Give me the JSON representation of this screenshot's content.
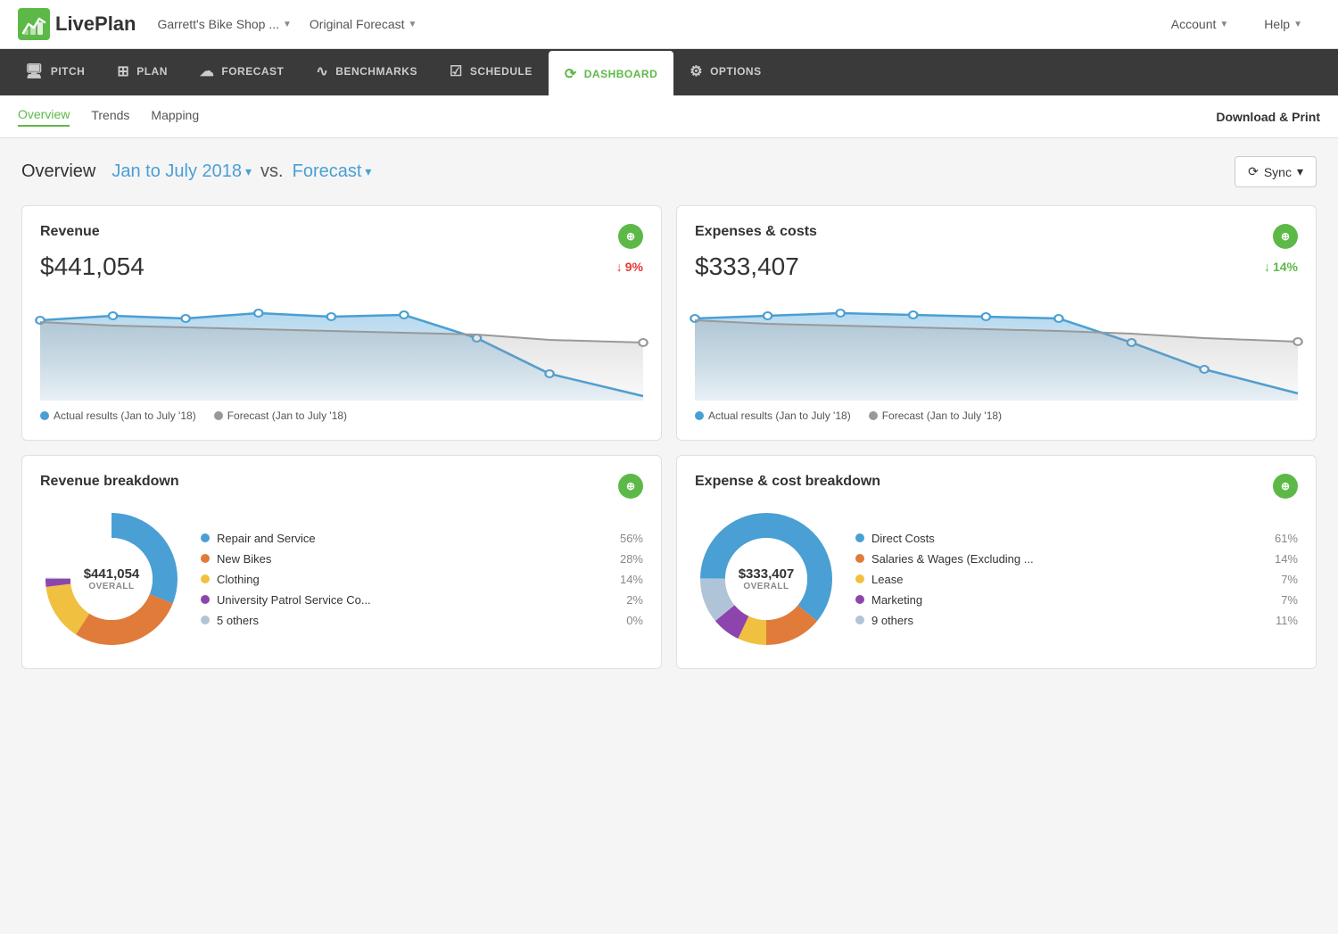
{
  "app": {
    "logo_text": "LivePlan",
    "company": "Garrett's Bike Shop ...",
    "forecast_mode": "Original Forecast",
    "account_label": "Account",
    "help_label": "Help"
  },
  "main_nav": {
    "tabs": [
      {
        "id": "pitch",
        "label": "PITCH",
        "icon": "🖥"
      },
      {
        "id": "plan",
        "label": "PLAN",
        "icon": "📋"
      },
      {
        "id": "forecast",
        "label": "FORECAST",
        "icon": "🔮"
      },
      {
        "id": "benchmarks",
        "label": "BENCHMARKS",
        "icon": "📈"
      },
      {
        "id": "schedule",
        "label": "SCHEDULE",
        "icon": "☑"
      },
      {
        "id": "dashboard",
        "label": "DASHBOARD",
        "icon": "🔄",
        "active": true
      },
      {
        "id": "options",
        "label": "OPTIONS",
        "icon": "⚙"
      }
    ]
  },
  "sub_nav": {
    "items": [
      {
        "label": "Overview",
        "active": true
      },
      {
        "label": "Trends",
        "active": false
      },
      {
        "label": "Mapping",
        "active": false
      }
    ],
    "right_action": "Download & Print"
  },
  "overview": {
    "title": "Overview",
    "period": "Jan to July 2018",
    "vs_label": "vs.",
    "comparison": "Forecast",
    "sync_label": "Sync"
  },
  "revenue_card": {
    "title": "Revenue",
    "value": "$441,054",
    "change": "9%",
    "change_direction": "down",
    "change_type": "bad",
    "legend_actual": "Actual results (Jan to July '18)",
    "legend_forecast": "Forecast (Jan to July '18)"
  },
  "expenses_card": {
    "title": "Expenses & costs",
    "value": "$333,407",
    "change": "14%",
    "change_direction": "down",
    "change_type": "good",
    "legend_actual": "Actual results (Jan to July '18)",
    "legend_forecast": "Forecast (Jan to July '18)"
  },
  "revenue_breakdown": {
    "title": "Revenue breakdown",
    "total": "$441,054",
    "total_label": "OVERALL",
    "items": [
      {
        "name": "Repair and Service",
        "pct": "56%",
        "color": "#4a9fd4"
      },
      {
        "name": "New Bikes",
        "pct": "28%",
        "color": "#e07b3a"
      },
      {
        "name": "Clothing",
        "pct": "14%",
        "color": "#f0c040"
      },
      {
        "name": "University Patrol Service Co...",
        "pct": "2%",
        "color": "#8e44ad"
      },
      {
        "name": "5 others",
        "pct": "0%",
        "color": "#b0c4d8"
      }
    ]
  },
  "expense_breakdown": {
    "title": "Expense & cost breakdown",
    "total": "$333,407",
    "total_label": "OVERALL",
    "items": [
      {
        "name": "Direct Costs",
        "pct": "61%",
        "color": "#4a9fd4"
      },
      {
        "name": "Salaries & Wages (Excluding ...",
        "pct": "14%",
        "color": "#e07b3a"
      },
      {
        "name": "Lease",
        "pct": "7%",
        "color": "#f0c040"
      },
      {
        "name": "Marketing",
        "pct": "7%",
        "color": "#8e44ad"
      },
      {
        "name": "9 others",
        "pct": "11%",
        "color": "#b0c4d8"
      }
    ]
  },
  "colors": {
    "green": "#5db947",
    "blue": "#4a9fd4",
    "orange": "#e07b3a",
    "red": "#e53935",
    "gray": "#999",
    "dark_nav": "#3a3a3a"
  }
}
